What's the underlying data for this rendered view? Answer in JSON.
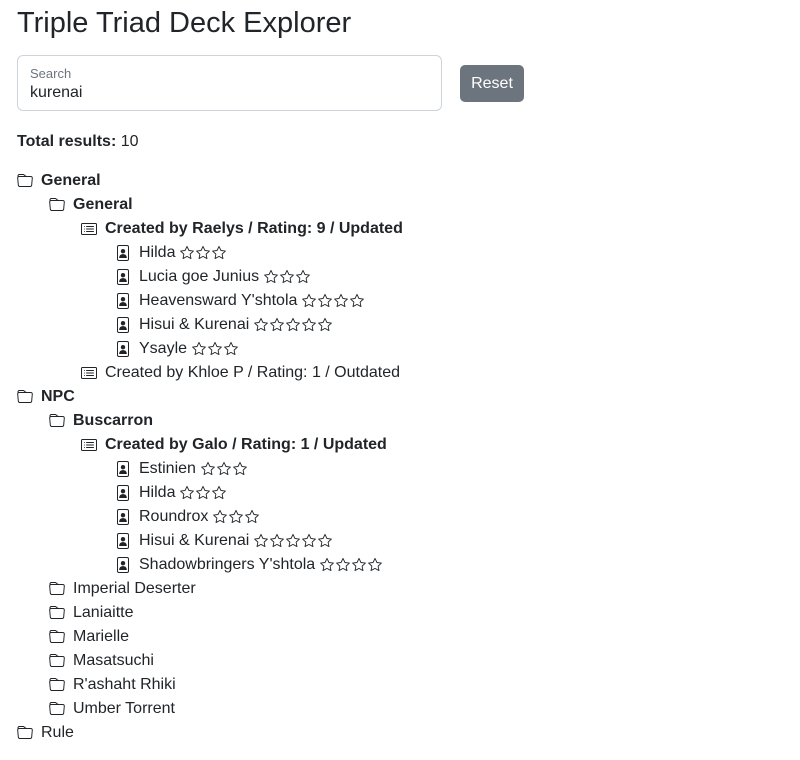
{
  "page": {
    "title": "Triple Triad Deck Explorer"
  },
  "search": {
    "label": "Search",
    "value": "kurenai"
  },
  "reset_label": "Reset",
  "total": {
    "label": "Total results:",
    "value": "10"
  },
  "tree": [
    {
      "type": "folder",
      "level": 0,
      "bold": true,
      "label": "General"
    },
    {
      "type": "folder",
      "level": 1,
      "bold": true,
      "label": "General"
    },
    {
      "type": "deck",
      "level": 2,
      "bold": true,
      "label": "Created by Raelys / Rating: 9 / Updated"
    },
    {
      "type": "card",
      "level": 3,
      "label": "Hilda",
      "stars": 3
    },
    {
      "type": "card",
      "level": 3,
      "label": "Lucia goe Junius",
      "stars": 3
    },
    {
      "type": "card",
      "level": 3,
      "label": "Heavensward Y'shtola",
      "stars": 4
    },
    {
      "type": "card",
      "level": 3,
      "label": "Hisui & Kurenai",
      "stars": 5
    },
    {
      "type": "card",
      "level": 3,
      "label": "Ysayle",
      "stars": 3
    },
    {
      "type": "deck",
      "level": 2,
      "bold": false,
      "label": "Created by Khloe P / Rating: 1 / Outdated"
    },
    {
      "type": "folder",
      "level": 0,
      "bold": true,
      "label": "NPC"
    },
    {
      "type": "folder",
      "level": 1,
      "bold": true,
      "label": "Buscarron"
    },
    {
      "type": "deck",
      "level": 2,
      "bold": true,
      "label": "Created by Galo / Rating: 1 / Updated"
    },
    {
      "type": "card",
      "level": 3,
      "label": "Estinien",
      "stars": 3
    },
    {
      "type": "card",
      "level": 3,
      "label": "Hilda",
      "stars": 3
    },
    {
      "type": "card",
      "level": 3,
      "label": "Roundrox",
      "stars": 3
    },
    {
      "type": "card",
      "level": 3,
      "label": "Hisui & Kurenai",
      "stars": 5
    },
    {
      "type": "card",
      "level": 3,
      "label": "Shadowbringers Y'shtola",
      "stars": 4
    },
    {
      "type": "folder",
      "level": 1,
      "bold": false,
      "label": "Imperial Deserter"
    },
    {
      "type": "folder",
      "level": 1,
      "bold": false,
      "label": "Laniaitte"
    },
    {
      "type": "folder",
      "level": 1,
      "bold": false,
      "label": "Marielle"
    },
    {
      "type": "folder",
      "level": 1,
      "bold": false,
      "label": "Masatsuchi"
    },
    {
      "type": "folder",
      "level": 1,
      "bold": false,
      "label": "R'ashaht Rhiki"
    },
    {
      "type": "folder",
      "level": 1,
      "bold": false,
      "label": "Umber Torrent"
    },
    {
      "type": "folder",
      "level": 0,
      "bold": false,
      "label": "Rule"
    }
  ],
  "icons": {
    "folder": "folder-icon",
    "deck": "card-list-icon",
    "card": "person-card-icon",
    "star": "star-outline-icon"
  },
  "colors": {
    "text": "#212529",
    "button_bg": "#6c757d",
    "muted": "#6c757d",
    "border": "#ced4da"
  }
}
